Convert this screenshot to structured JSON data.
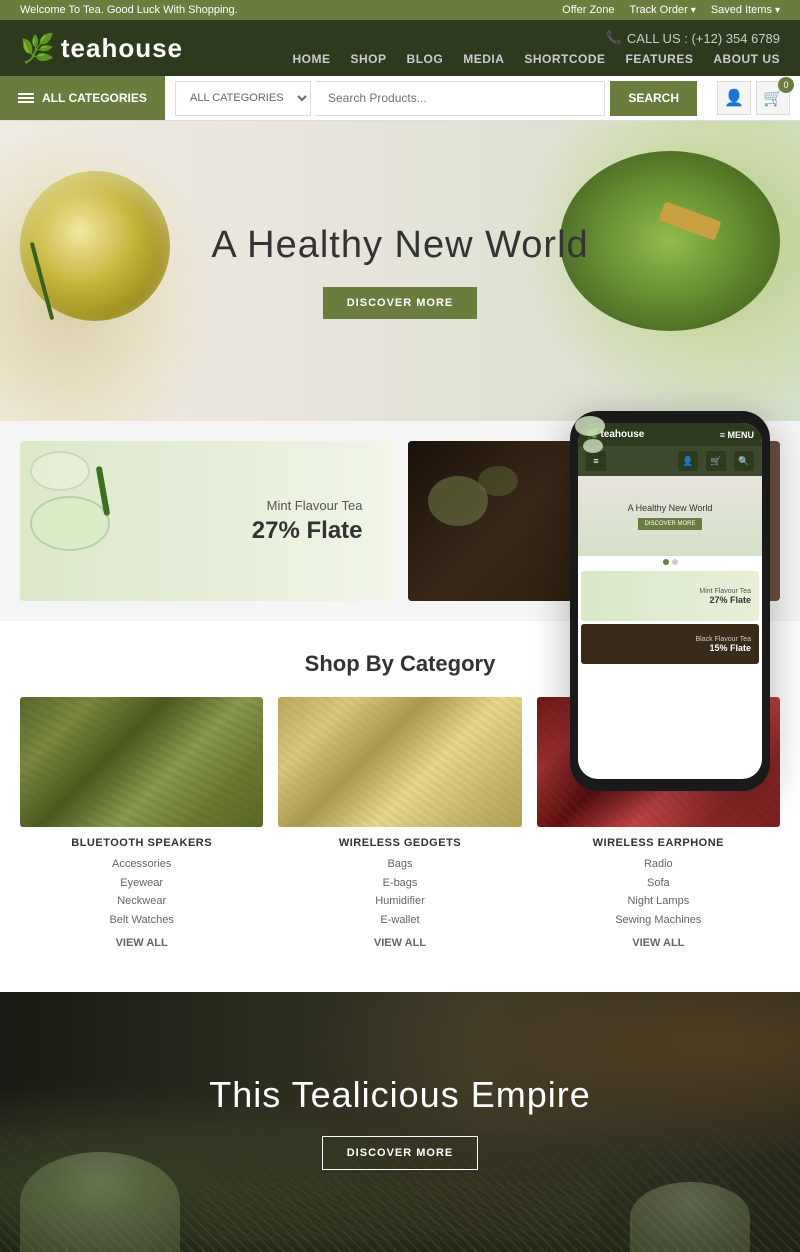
{
  "topbar": {
    "welcome": "Welcome To Tea. Good Luck With Shopping.",
    "offer_zone": "Offer Zone",
    "track_order": "Track Order",
    "saved_items": "Saved Items"
  },
  "header": {
    "logo_text": "teahouse",
    "phone_label": "CALL US : (+12) 354 6789",
    "nav": {
      "items": [
        {
          "label": "HOME",
          "id": "home"
        },
        {
          "label": "SHOP",
          "id": "shop"
        },
        {
          "label": "BLOG",
          "id": "blog"
        },
        {
          "label": "MEDIA",
          "id": "media"
        },
        {
          "label": "SHORTCODE",
          "id": "shortcode"
        },
        {
          "label": "FEATURES",
          "id": "features"
        },
        {
          "label": "ABOUT US",
          "id": "about"
        }
      ]
    }
  },
  "catbar": {
    "btn_label": "ALL CATEGORIES",
    "select_label": "ALL CATEGORIES",
    "search_placeholder": "Search Products...",
    "search_btn": "SEARCH"
  },
  "hero": {
    "title": "A Healthy New World",
    "btn_label": "DISCOVER MORE"
  },
  "promo": {
    "left": {
      "subtitle": "Mint Flavour Tea",
      "discount": "27% Flate"
    },
    "right": {
      "subtitle": "Black Flavour Tea",
      "discount": "15% Flate"
    }
  },
  "shop_by_category": {
    "title": "Shop By Category",
    "categories": [
      {
        "name": "BLUETOOTH SPEAKERS",
        "links": [
          "Accessories",
          "Eyewear",
          "Neckwear",
          "Belt Watches"
        ],
        "view_all": "VIEW ALL"
      },
      {
        "name": "WIRELESS GEDGETS",
        "links": [
          "Bags",
          "E-bags",
          "Humidifier",
          "E-wallet"
        ],
        "view_all": "VIEW ALL"
      },
      {
        "name": "WIRELESS EARPHONE",
        "links": [
          "Radio",
          "Sofa",
          "Night Lamps",
          "Sewing Machines"
        ],
        "view_all": "VIEW ALL"
      }
    ]
  },
  "phone_mockup": {
    "logo": "teahouse",
    "menu": "≡ MENU",
    "hero_title": "A Healthy New World",
    "hero_btn": "DISCOVER MORE",
    "promo1_subtitle": "Mint Flavour Tea",
    "promo1_discount": "27% Flate",
    "promo2_subtitle": "Black Flavour Tea",
    "promo2_discount": "15% Flate"
  },
  "bottom_hero": {
    "title": "This Tealicious Empire",
    "btn_label": "DISCOVER MORE"
  },
  "colors": {
    "brand_green": "#6b7c3f",
    "dark_green": "#2d3a1e"
  }
}
